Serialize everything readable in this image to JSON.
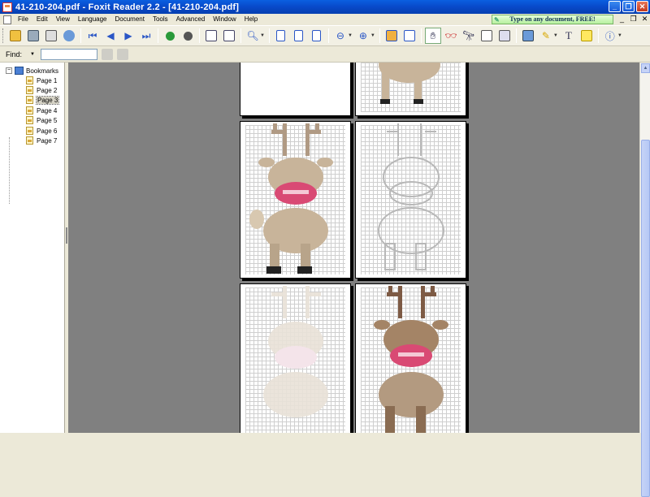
{
  "window": {
    "title": "41-210-204.pdf - Foxit Reader 2.2 - [41-210-204.pdf]"
  },
  "menu": [
    "File",
    "Edit",
    "View",
    "Language",
    "Document",
    "Tools",
    "Advanced",
    "Window",
    "Help"
  ],
  "ad_banner": "Type on any document, FREE!",
  "find": {
    "label": "Find:",
    "value": ""
  },
  "bookmarks": {
    "root": "Bookmarks",
    "pages": [
      "Page 1",
      "Page 2",
      "Page 3",
      "Page 4",
      "Page 5",
      "Page 6",
      "Page 7"
    ],
    "selected_index": 2
  },
  "toolbar_icons": [
    "open-icon",
    "save-icon",
    "print-icon",
    "email-icon",
    "first-page-icon",
    "previous-page-icon",
    "next-page-icon",
    "last-page-icon",
    "go-back-icon",
    "go-forward-icon",
    "rotate-left-icon",
    "rotate-right-icon",
    "zoom-icon",
    "actual-size-icon",
    "fit-page-icon",
    "fit-width-icon",
    "zoom-out-icon",
    "zoom-in-icon",
    "bookmarks-panel-icon",
    "thumbnails-panel-icon",
    "hand-tool-icon",
    "select-text-icon",
    "find-icon",
    "typewriter-icon",
    "snapshot-icon",
    "comment-icon",
    "highlight-icon",
    "text-tool-icon",
    "note-icon",
    "info-icon"
  ],
  "colors": {
    "titlebar": "#0a5fe0",
    "viewer_bg": "#808080",
    "deer_brown": "#c8b49a",
    "nose_pink": "#d94a74"
  }
}
